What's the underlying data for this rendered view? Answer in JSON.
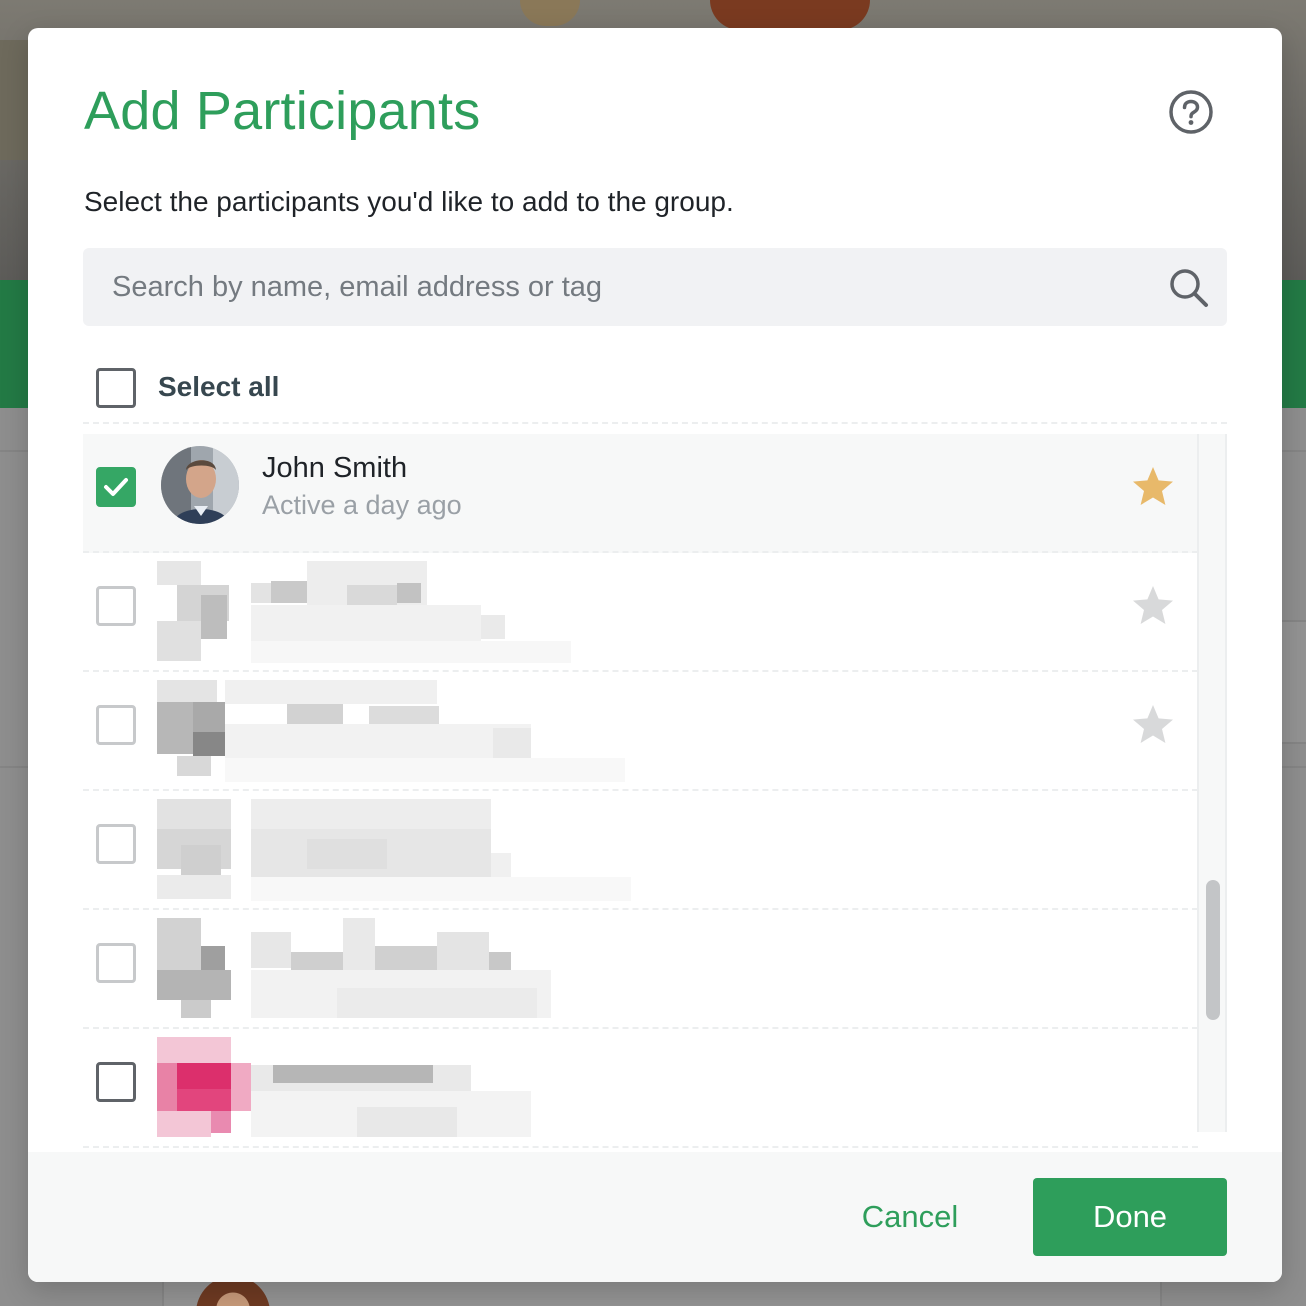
{
  "modal": {
    "title": "Add Participants",
    "description": "Select the participants you'd like to add to the group.",
    "help_icon": "question-circle-icon"
  },
  "search": {
    "placeholder": "Search by name, email address or tag",
    "value": "",
    "icon": "search-icon"
  },
  "select_all": {
    "label": "Select all",
    "checked": false
  },
  "participants": [
    {
      "name": "John Smith",
      "status": "Active a day ago",
      "checked": true,
      "starred": true,
      "redacted": false
    },
    {
      "name": "",
      "status": "",
      "checked": false,
      "starred": false,
      "redacted": true
    },
    {
      "name": "",
      "status": "",
      "checked": false,
      "starred": false,
      "redacted": true
    },
    {
      "name": "",
      "status": "",
      "checked": false,
      "starred": false,
      "redacted": true
    },
    {
      "name": "",
      "status": "",
      "checked": false,
      "starred": false,
      "redacted": true
    },
    {
      "name": "",
      "status": "",
      "checked": false,
      "starred": false,
      "redacted": true
    }
  ],
  "footer": {
    "cancel_label": "Cancel",
    "done_label": "Done"
  },
  "colors": {
    "brand_green": "#2e9e5b",
    "checkbox_green": "#35a765",
    "star_gold": "#e8b96a",
    "star_gray": "#d8d9da"
  }
}
